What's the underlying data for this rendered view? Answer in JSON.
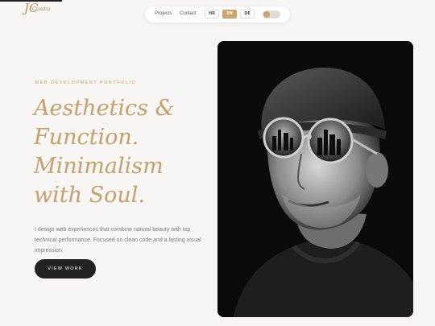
{
  "brand": {
    "monogram": "JC",
    "wordmark": "Croatia"
  },
  "nav": {
    "links": [
      "Projects",
      "Contact"
    ],
    "languages": [
      {
        "code": "HR",
        "active": false
      },
      {
        "code": "EN",
        "active": true
      },
      {
        "code": "DE",
        "active": false
      }
    ],
    "theme_toggle": "off"
  },
  "hero": {
    "eyebrow": "WEB DEVELOPMENT PORTFOLIO",
    "headline_lines": [
      "Aesthetics &",
      "Function.",
      "Minimalism",
      "with Soul."
    ],
    "description": "I design web experiences that combine natural beauty with top technical performance. Focused on clean code and a lasting visual impression.",
    "cta_label": "VIEW WORK"
  },
  "colors": {
    "accent": "#c5a06b",
    "dark": "#222222",
    "background": "#f7f6f4"
  },
  "portrait": {
    "icon": "portrait-photo",
    "style": "black-and-white"
  }
}
